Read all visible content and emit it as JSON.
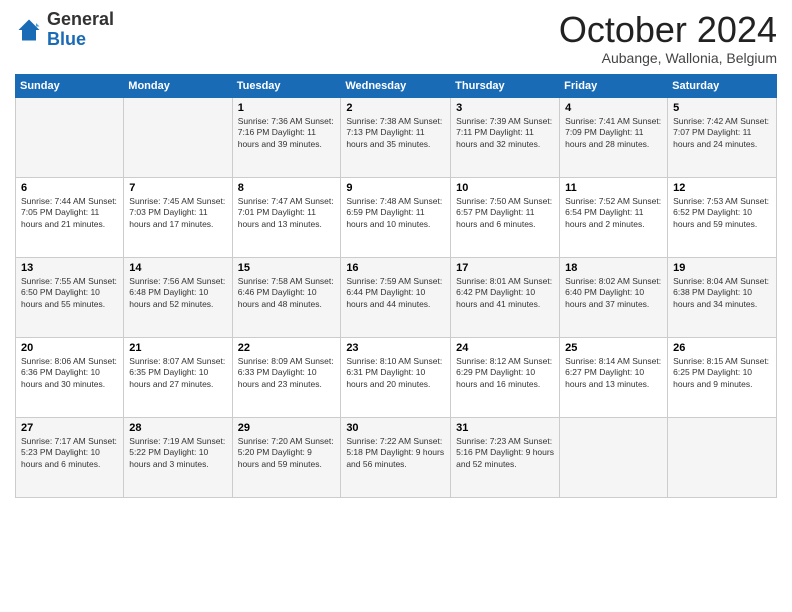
{
  "logo": {
    "general": "General",
    "blue": "Blue"
  },
  "header": {
    "month": "October 2024",
    "location": "Aubange, Wallonia, Belgium"
  },
  "days_of_week": [
    "Sunday",
    "Monday",
    "Tuesday",
    "Wednesday",
    "Thursday",
    "Friday",
    "Saturday"
  ],
  "weeks": [
    [
      {
        "day": "",
        "info": ""
      },
      {
        "day": "",
        "info": ""
      },
      {
        "day": "1",
        "info": "Sunrise: 7:36 AM\nSunset: 7:16 PM\nDaylight: 11 hours and 39 minutes."
      },
      {
        "day": "2",
        "info": "Sunrise: 7:38 AM\nSunset: 7:13 PM\nDaylight: 11 hours and 35 minutes."
      },
      {
        "day": "3",
        "info": "Sunrise: 7:39 AM\nSunset: 7:11 PM\nDaylight: 11 hours and 32 minutes."
      },
      {
        "day": "4",
        "info": "Sunrise: 7:41 AM\nSunset: 7:09 PM\nDaylight: 11 hours and 28 minutes."
      },
      {
        "day": "5",
        "info": "Sunrise: 7:42 AM\nSunset: 7:07 PM\nDaylight: 11 hours and 24 minutes."
      }
    ],
    [
      {
        "day": "6",
        "info": "Sunrise: 7:44 AM\nSunset: 7:05 PM\nDaylight: 11 hours and 21 minutes."
      },
      {
        "day": "7",
        "info": "Sunrise: 7:45 AM\nSunset: 7:03 PM\nDaylight: 11 hours and 17 minutes."
      },
      {
        "day": "8",
        "info": "Sunrise: 7:47 AM\nSunset: 7:01 PM\nDaylight: 11 hours and 13 minutes."
      },
      {
        "day": "9",
        "info": "Sunrise: 7:48 AM\nSunset: 6:59 PM\nDaylight: 11 hours and 10 minutes."
      },
      {
        "day": "10",
        "info": "Sunrise: 7:50 AM\nSunset: 6:57 PM\nDaylight: 11 hours and 6 minutes."
      },
      {
        "day": "11",
        "info": "Sunrise: 7:52 AM\nSunset: 6:54 PM\nDaylight: 11 hours and 2 minutes."
      },
      {
        "day": "12",
        "info": "Sunrise: 7:53 AM\nSunset: 6:52 PM\nDaylight: 10 hours and 59 minutes."
      }
    ],
    [
      {
        "day": "13",
        "info": "Sunrise: 7:55 AM\nSunset: 6:50 PM\nDaylight: 10 hours and 55 minutes."
      },
      {
        "day": "14",
        "info": "Sunrise: 7:56 AM\nSunset: 6:48 PM\nDaylight: 10 hours and 52 minutes."
      },
      {
        "day": "15",
        "info": "Sunrise: 7:58 AM\nSunset: 6:46 PM\nDaylight: 10 hours and 48 minutes."
      },
      {
        "day": "16",
        "info": "Sunrise: 7:59 AM\nSunset: 6:44 PM\nDaylight: 10 hours and 44 minutes."
      },
      {
        "day": "17",
        "info": "Sunrise: 8:01 AM\nSunset: 6:42 PM\nDaylight: 10 hours and 41 minutes."
      },
      {
        "day": "18",
        "info": "Sunrise: 8:02 AM\nSunset: 6:40 PM\nDaylight: 10 hours and 37 minutes."
      },
      {
        "day": "19",
        "info": "Sunrise: 8:04 AM\nSunset: 6:38 PM\nDaylight: 10 hours and 34 minutes."
      }
    ],
    [
      {
        "day": "20",
        "info": "Sunrise: 8:06 AM\nSunset: 6:36 PM\nDaylight: 10 hours and 30 minutes."
      },
      {
        "day": "21",
        "info": "Sunrise: 8:07 AM\nSunset: 6:35 PM\nDaylight: 10 hours and 27 minutes."
      },
      {
        "day": "22",
        "info": "Sunrise: 8:09 AM\nSunset: 6:33 PM\nDaylight: 10 hours and 23 minutes."
      },
      {
        "day": "23",
        "info": "Sunrise: 8:10 AM\nSunset: 6:31 PM\nDaylight: 10 hours and 20 minutes."
      },
      {
        "day": "24",
        "info": "Sunrise: 8:12 AM\nSunset: 6:29 PM\nDaylight: 10 hours and 16 minutes."
      },
      {
        "day": "25",
        "info": "Sunrise: 8:14 AM\nSunset: 6:27 PM\nDaylight: 10 hours and 13 minutes."
      },
      {
        "day": "26",
        "info": "Sunrise: 8:15 AM\nSunset: 6:25 PM\nDaylight: 10 hours and 9 minutes."
      }
    ],
    [
      {
        "day": "27",
        "info": "Sunrise: 7:17 AM\nSunset: 5:23 PM\nDaylight: 10 hours and 6 minutes."
      },
      {
        "day": "28",
        "info": "Sunrise: 7:19 AM\nSunset: 5:22 PM\nDaylight: 10 hours and 3 minutes."
      },
      {
        "day": "29",
        "info": "Sunrise: 7:20 AM\nSunset: 5:20 PM\nDaylight: 9 hours and 59 minutes."
      },
      {
        "day": "30",
        "info": "Sunrise: 7:22 AM\nSunset: 5:18 PM\nDaylight: 9 hours and 56 minutes."
      },
      {
        "day": "31",
        "info": "Sunrise: 7:23 AM\nSunset: 5:16 PM\nDaylight: 9 hours and 52 minutes."
      },
      {
        "day": "",
        "info": ""
      },
      {
        "day": "",
        "info": ""
      }
    ]
  ]
}
